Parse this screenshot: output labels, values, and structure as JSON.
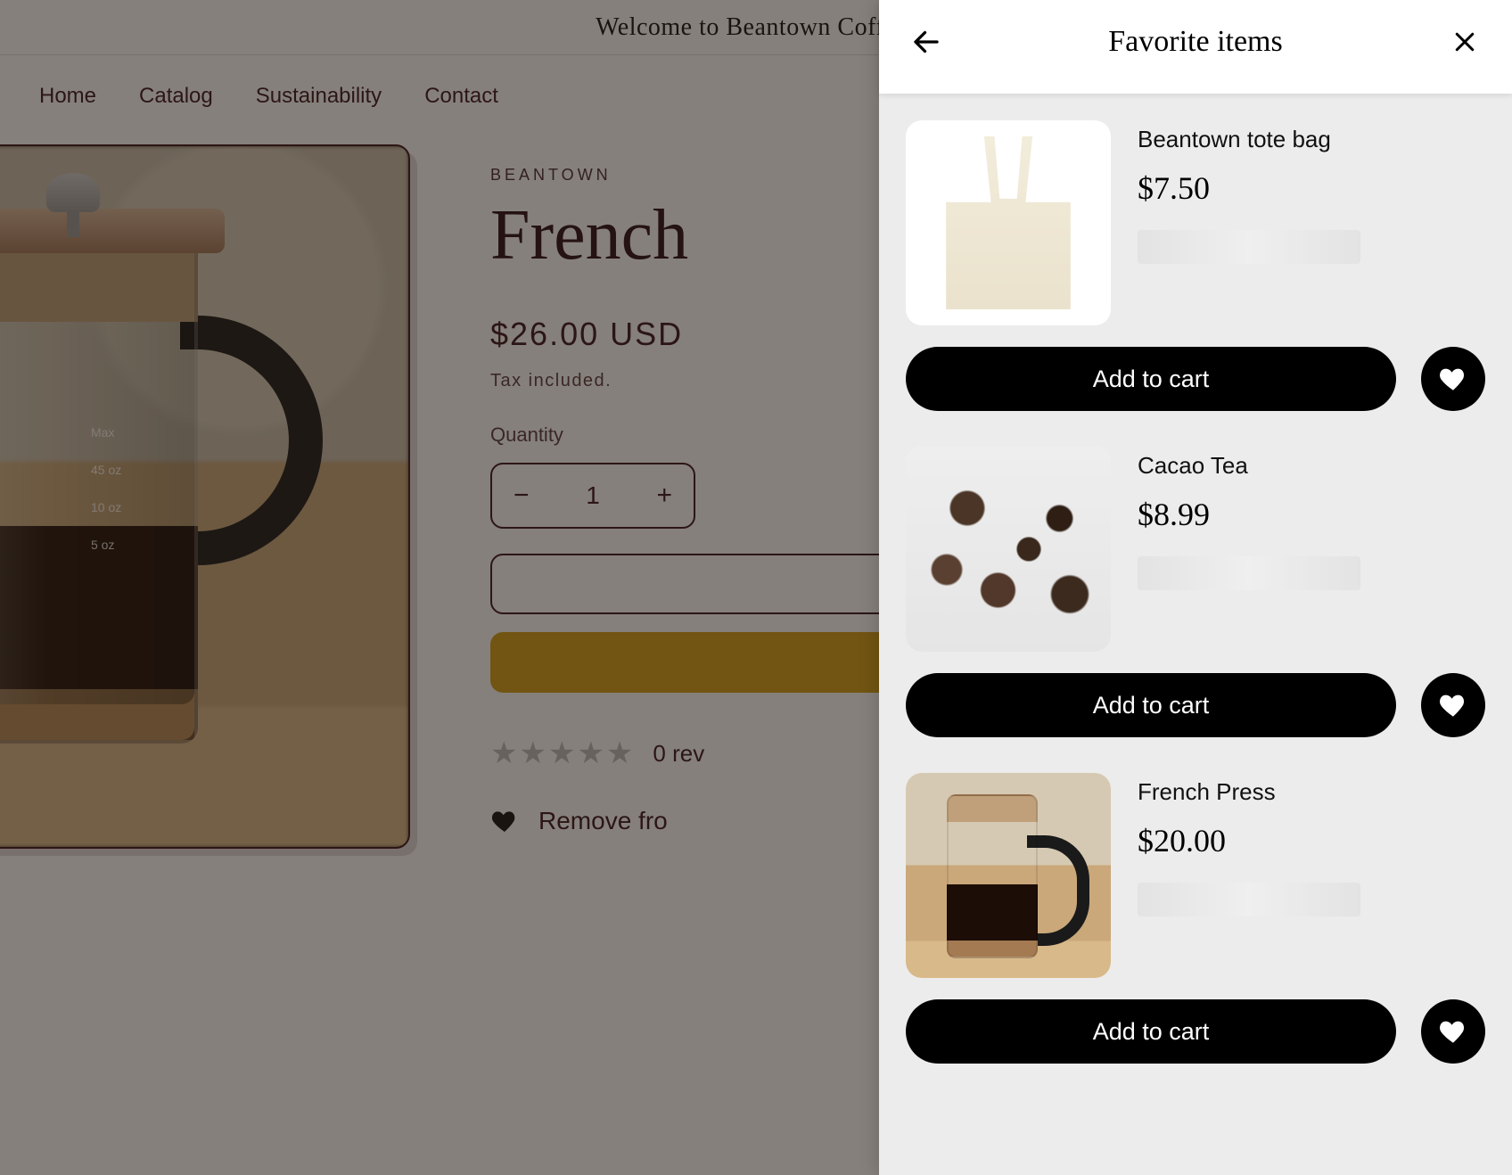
{
  "announcement": "Welcome to Beantown Coffee!",
  "nav": [
    "Home",
    "Catalog",
    "Sustainability",
    "Contact"
  ],
  "product": {
    "vendor": "BEANTOWN",
    "title": "French",
    "price": "$26.00 USD",
    "tax_note": "Tax included.",
    "quantity_label": "Quantity",
    "quantity_value": "1",
    "reviews_text": "0 rev",
    "remove_label": "Remove fro",
    "image_marks": {
      "a": "Max",
      "b": "45 oz",
      "c": "10 oz",
      "d": "5 oz"
    }
  },
  "drawer": {
    "title": "Favorite items",
    "add_to_cart_label": "Add to cart",
    "items": [
      {
        "name": "Beantown tote bag",
        "price": "$7.50"
      },
      {
        "name": "Cacao Tea",
        "price": "$8.99"
      },
      {
        "name": "French Press",
        "price": "$20.00"
      }
    ]
  }
}
